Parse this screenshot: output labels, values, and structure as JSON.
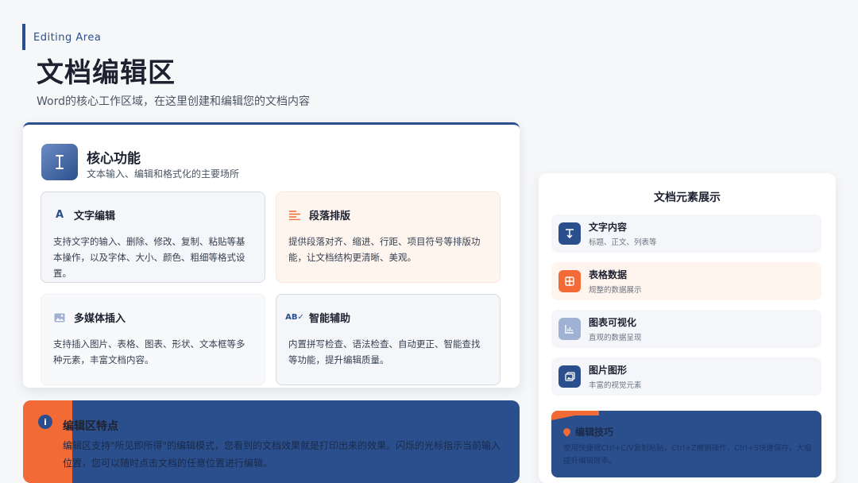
{
  "header": {
    "eyebrow": "Editing Area",
    "title": "文档编辑区",
    "subtitle": "Word的核心工作区域，在这里创建和编辑您的文档内容"
  },
  "core": {
    "title": "核心功能",
    "desc": "文本输入、编辑和格式化的主要场所",
    "features": [
      {
        "icon": "letter-a-icon",
        "title": "文字编辑",
        "text": "支持文字的输入、删除、修改、复制、粘贴等基本操作，以及字体、大小、颜色、粗细等格式设置。"
      },
      {
        "icon": "paragraph-lines-icon",
        "title": "段落排版",
        "text": "提供段落对齐、缩进、行距、项目符号等排版功能，让文档结构更清晰、美观。"
      },
      {
        "icon": "image-icon",
        "title": "多媒体插入",
        "text": "支持插入图片、表格、图表、形状、文本框等多种元素，丰富文档内容。"
      },
      {
        "icon": "spellcheck-icon",
        "title": "智能辅助",
        "text": "内置拼写检查、语法检查、自动更正、智能查找等功能，提升编辑质量。"
      }
    ]
  },
  "traits": {
    "title": "编辑区特点",
    "text": "编辑区支持\"所见即所得\"的编辑模式，您看到的文档效果就是打印出来的效果。闪烁的光标指示当前输入位置，您可以随时点击文档的任意位置进行编辑。"
  },
  "elements": {
    "title": "文档元素展示",
    "items": [
      {
        "icon": "text-icon",
        "name": "文字内容",
        "sub": "标题、正文、列表等"
      },
      {
        "icon": "table-icon",
        "name": "表格数据",
        "sub": "规整的数据展示"
      },
      {
        "icon": "chart-icon",
        "name": "图表可视化",
        "sub": "直观的数据呈现"
      },
      {
        "icon": "picture-icon",
        "name": "图片图形",
        "sub": "丰富的视觉元素"
      }
    ],
    "tips": {
      "title": "编辑技巧",
      "text": "使用快捷键Ctrl+C/V复制粘贴，Ctrl+Z撤销操作，Ctrl+S快速保存，大幅提升编辑效率。"
    }
  },
  "colors": {
    "primary": "#2b4f8c",
    "accent": "#f26a35"
  }
}
